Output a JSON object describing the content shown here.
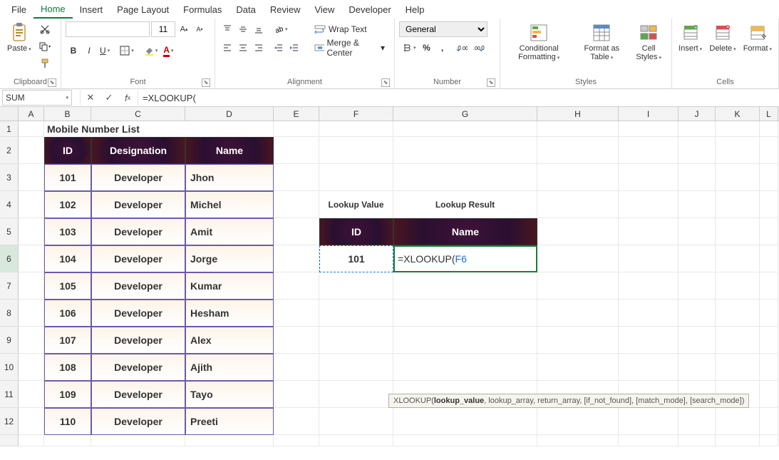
{
  "menu": {
    "items": [
      "File",
      "Home",
      "Insert",
      "Page Layout",
      "Formulas",
      "Data",
      "Review",
      "View",
      "Developer",
      "Help"
    ],
    "active": "Home"
  },
  "ribbon": {
    "clipboard": {
      "label": "Clipboard",
      "paste": "Paste"
    },
    "font": {
      "label": "Font",
      "name": "",
      "size": "11"
    },
    "alignment": {
      "label": "Alignment",
      "wrap": "Wrap Text",
      "merge": "Merge & Center"
    },
    "number": {
      "label": "Number",
      "format": "General"
    },
    "styles": {
      "label": "Styles",
      "cond": "Conditional Formatting",
      "fmt": "Format as Table",
      "cell": "Cell Styles"
    },
    "cells": {
      "label": "Cells",
      "insert": "Insert",
      "delete": "Delete",
      "format": "Format"
    }
  },
  "formula_bar": {
    "namebox": "SUM",
    "formula": "=XLOOKUP("
  },
  "columns": [
    "",
    "A",
    "B",
    "C",
    "D",
    "E",
    "F",
    "G",
    "H",
    "I",
    "J",
    "K",
    "L"
  ],
  "table": {
    "title": "Mobile Number List",
    "headers": {
      "b": "ID",
      "c": "Designation",
      "d": "Name"
    },
    "rows": [
      {
        "id": "101",
        "desig": "Developer",
        "name": "Jhon"
      },
      {
        "id": "102",
        "desig": "Developer",
        "name": "Michel"
      },
      {
        "id": "103",
        "desig": "Developer",
        "name": "Amit"
      },
      {
        "id": "104",
        "desig": "Developer",
        "name": "Jorge"
      },
      {
        "id": "105",
        "desig": "Developer",
        "name": "Kumar"
      },
      {
        "id": "106",
        "desig": "Developer",
        "name": "Hesham"
      },
      {
        "id": "107",
        "desig": "Developer",
        "name": "Alex"
      },
      {
        "id": "108",
        "desig": "Developer",
        "name": "Ajith"
      },
      {
        "id": "109",
        "desig": "Developer",
        "name": "Tayo"
      },
      {
        "id": "110",
        "desig": "Developer",
        "name": "Preeti"
      }
    ]
  },
  "lookup": {
    "val_label": "Lookup Value",
    "res_label": "Lookup Result",
    "id_head": "ID",
    "name_head": "Name",
    "val": "101",
    "formula_prefix": "=XLOOKUP(",
    "formula_ref": "F6"
  },
  "tooltip": {
    "fn": "XLOOKUP(",
    "arg1": "lookup_value",
    "rest": ", lookup_array, return_array, [if_not_found], [match_mode], [search_mode])"
  },
  "rownums": [
    "1",
    "2",
    "3",
    "4",
    "5",
    "6",
    "7",
    "8",
    "9",
    "10",
    "11",
    "12"
  ]
}
